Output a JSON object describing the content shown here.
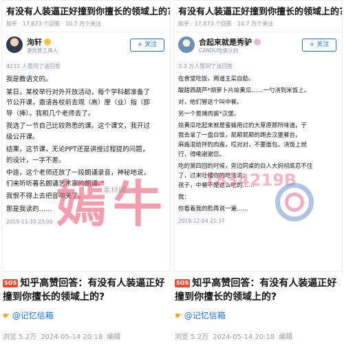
{
  "left_card": {
    "question_title": "有没有人装逼正好撞到你擅长的领域上的?",
    "question_meta": "知乎 · 17,873 个回答 · 10.7 万个关注",
    "author_name": "洵轩",
    "author_sub": "激优质工具人",
    "follow_label": "+ 关注",
    "agree_text": "4232 人赞同了该回答",
    "paragraphs": [
      "我是教语文的。",
      "某日，某校举行对外开放活动，每个学科都准备了",
      "节公开课，邀请各校前去观（高）摩（业）指（即",
      "导（捧）。我和几个老师去了。",
      "我选了一节自己比较熟悉的课。这个课文，我开过",
      "级公开课。",
      "结果，这节课，无论PPT还是讲授过程提的问题，",
      "的设计，一字不差。",
      "中途，这个老师还放了一段朗诵录音，神秘地说，",
      "们来听听著名朗诵艺术家的朗诵。”",
      "我恨不得上去把音响关了。",
      "那是我读的……"
    ],
    "date": "2019-11-30 23:00"
  },
  "right_card": {
    "question_title": "有没有人装逼正好撞到你擅长的领域上的?",
    "question_meta": "知乎 · 17,873 个回答 · 10.7 万个关注",
    "author_name": "合起来就是秀驴",
    "author_sub": "CANDU吃饭认的",
    "follow_label": "+ 关注",
    "agree_text": "3.3 万人赞同了该回答",
    "paragraphs": [
      "在食堂吃饭，两道主菜自助。",
      "酸甜西葫芦*胡萝卜片烩黄瓜……一勺浇到米饭上。",
      "对，他们管这个叫中餐。",
      "另一个是辣肉酱*汉堡。",
      "烩黄瓜吃起来就是蜜蜂用过的大草原那所味道，于",
      "我去拿了一盘白饭，屁颠屁颠的跑去汉堡餐台，",
      "麻酱混给拌的肉酱，哎对对，不要面包，浇饭上就",
      "行，得嘞谢谢您。",
      "吃的第四回的时候，旁边同桌的白人大妈彻底忍不住",
      "了，过来吐槽你的吃法说：",
      "孩子，中餐不是这么吃的……",
      "我：",
      "你看着我的脸再说一遍……"
    ],
    "date": "2019-12-04 21:37"
  },
  "captions": [
    {
      "sos": "SOS",
      "title": "知乎高赞回答：有没有人装逼正好撞到你擅长的领域上的?",
      "source": "@记忆信箱",
      "views": "浏览 5.2万",
      "date": "2024-05-14 20:18",
      "edit": "编辑"
    },
    {
      "sos": "SOS",
      "title": "知乎高赞回答：有没有人装逼正好撞到你擅长的领域上的?",
      "source": "@记忆信箱",
      "views": "浏览 5.2万",
      "date": "2024-05-14 20:18",
      "edit": "编辑"
    }
  ],
  "watermark": {
    "text": "嫣牛",
    "number": "1834219B",
    "sub": "素材网"
  },
  "colors": {
    "accent": "#1772f6",
    "meta": "#8590a6",
    "sos": "#e8492c",
    "watermark": "#e84e6e"
  }
}
